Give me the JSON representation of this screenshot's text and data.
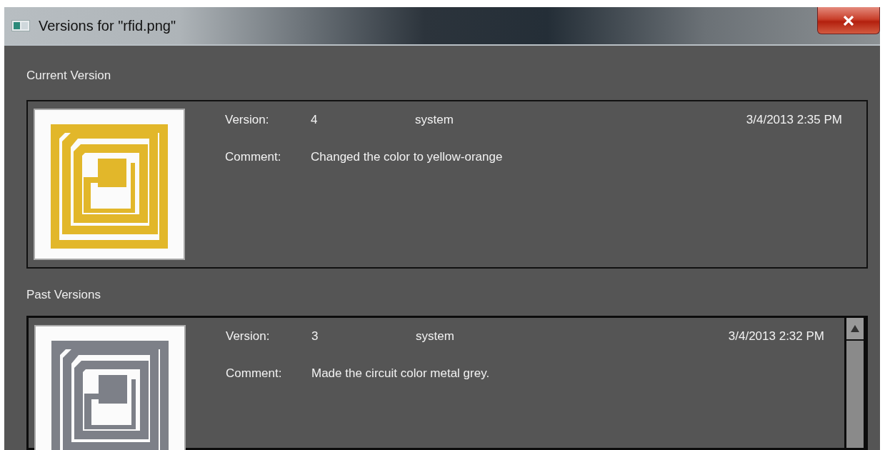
{
  "window": {
    "title": "Versions for \"rfid.png\""
  },
  "current": {
    "heading": "Current Version",
    "versions": [
      {
        "version_label": "Version:",
        "number": "4",
        "user": "system",
        "date": "3/4/2013 2:35 PM",
        "comment_label": "Comment:",
        "comment": "Changed the color to yellow-orange",
        "color": "#e2b72a"
      }
    ]
  },
  "past": {
    "heading": "Past Versions",
    "versions": [
      {
        "version_label": "Version:",
        "number": "3",
        "user": "system",
        "date": "3/4/2013 2:32 PM",
        "comment_label": "Comment:",
        "comment": "Made the circuit color metal grey.",
        "color": "#7d8088"
      }
    ]
  }
}
